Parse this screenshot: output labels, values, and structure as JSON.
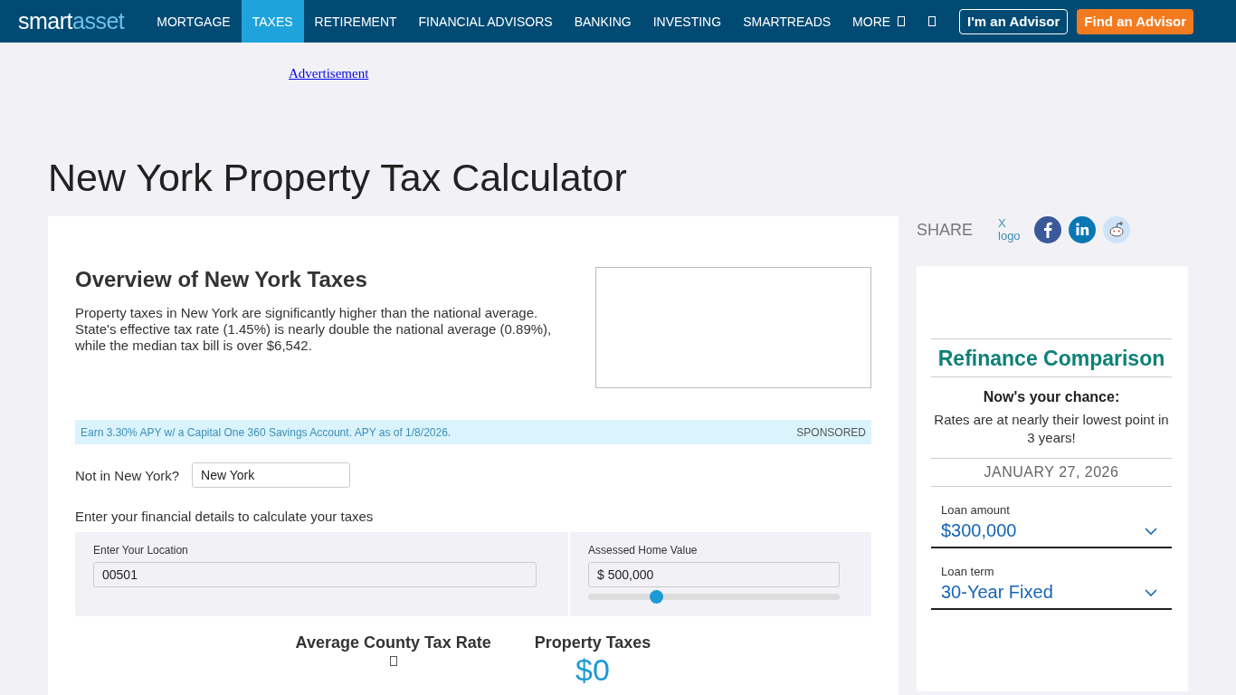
{
  "nav": {
    "logo_left": "smart",
    "logo_right": "asset",
    "items": [
      {
        "label": "MORTGAGE",
        "selected": false
      },
      {
        "label": "TAXES",
        "selected": true
      },
      {
        "label": "RETIREMENT",
        "selected": false
      },
      {
        "label": "FINANCIAL ADVISORS",
        "selected": false
      },
      {
        "label": "BANKING",
        "selected": false
      },
      {
        "label": "INVESTING",
        "selected": false
      },
      {
        "label": "SMARTREADS",
        "selected": false
      },
      {
        "label": "MORE",
        "selected": false
      }
    ],
    "buttons": [
      {
        "label": "I'm an Advisor",
        "kind": "outline"
      },
      {
        "label": "Find an Advisor",
        "kind": "filled"
      }
    ]
  },
  "ad": {
    "alt": "Advertisement"
  },
  "title": "New York Property Tax Calculator",
  "overview": {
    "heading": "Overview of New York Taxes",
    "text": "Property taxes in New York are significantly higher than the national average. State's effective tax rate (1.45%) is nearly double the national average (0.89%), while the median tax bill is over $6,542."
  },
  "sponsored": {
    "text": "Earn 3.30% APY w/ a Capital One 360 Savings Account. APY as of 1/8/2026.",
    "tag": "SPONSORED"
  },
  "state": {
    "label": "Not in New York?",
    "value": "New York"
  },
  "instructions": "Enter your financial details to calculate your taxes",
  "location": {
    "label": "Enter Your Location",
    "value": "00501"
  },
  "home_value": {
    "label": "Assessed Home Value",
    "value": "$ 500,000",
    "level": 0.27
  },
  "results": [
    {
      "label": "Average County Tax Rate"
    },
    {
      "label": "Property Taxes",
      "value": "$0"
    }
  ],
  "share": {
    "label": "SHARE",
    "x_alt": "X logo"
  },
  "refinance": {
    "title": "Refinance Comparison",
    "headline": "Now's your chance:",
    "text": "Rates are at nearly their lowest point in 3 years!",
    "date": "JANUARY 27, 2026",
    "fields": [
      {
        "label": "Loan amount",
        "value": "$300,000"
      },
      {
        "label": "Loan term",
        "value": "30-Year Fixed"
      }
    ]
  }
}
